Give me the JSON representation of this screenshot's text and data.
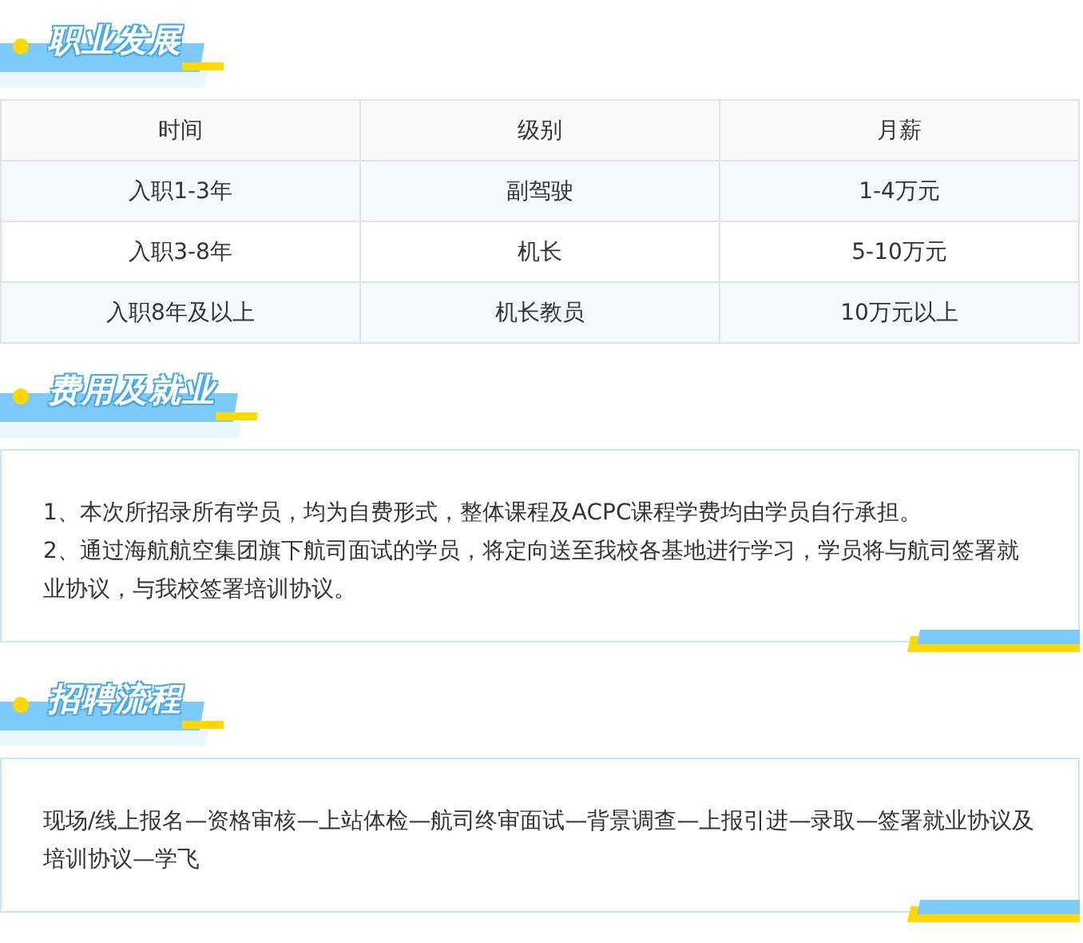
{
  "sections": [
    {
      "kind": "table",
      "heading": "职业发展",
      "table": {
        "columns": [
          "时间",
          "级别",
          "月薪"
        ],
        "rows": [
          [
            "入职1-3年",
            "副驾驶",
            "1-4万元"
          ],
          [
            "入职3-8年",
            "机长",
            "5-10万元"
          ],
          [
            "入职8年及以上",
            "机长教员",
            "10万元以上"
          ]
        ]
      }
    },
    {
      "kind": "text",
      "heading": "费用及就业",
      "paragraphs": [
        "1、本次所招录所有学员，均为自费形式，整体课程及ACPC课程学费均由学员自行承担。",
        "2、通过海航航空集团旗下航司面试的学员，将定向送至我校各基地进行学习，学员将与航司签署就业协议，与我校签署培训协议。"
      ]
    },
    {
      "kind": "text",
      "heading": "招聘流程",
      "paragraphs": [
        "现场/线上报名—资格审核—上站体检—航司终审面试—背景调查—上报引进—录取—签署就业协议及培训协议—学飞"
      ]
    }
  ]
}
